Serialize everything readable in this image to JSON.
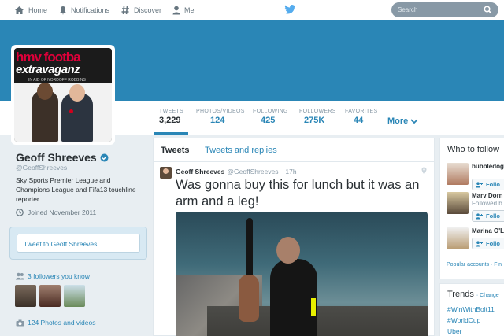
{
  "nav": {
    "home": "Home",
    "notifications": "Notifications",
    "discover": "Discover",
    "me": "Me",
    "search_placeholder": "Search"
  },
  "colors": {
    "accent": "#2a86b6",
    "header": "#2a86b6"
  },
  "stats": {
    "tweets": {
      "label": "TWEETS",
      "value": "3,229"
    },
    "photos": {
      "label": "PHOTOS/VIDEOS",
      "value": "124"
    },
    "following": {
      "label": "FOLLOWING",
      "value": "425"
    },
    "followers": {
      "label": "FOLLOWERS",
      "value": "275K"
    },
    "favorites": {
      "label": "FAVORITES",
      "value": "44"
    },
    "more": "More"
  },
  "avatar_banner": {
    "line1": "hmv footba",
    "line2": "extravaganz",
    "line3": "IN AID OF NORDOFF ROBBINS"
  },
  "profile": {
    "name": "Geoff Shreeves",
    "handle": "@GeoffShreeves",
    "bio": "Sky Sports Premier League and Champions League and Fifa13 touchline reporter",
    "joined": "Joined November 2011",
    "tweet_to": "Tweet to Geoff Shreeves",
    "followers_you_know": "3 followers you know",
    "photos_videos": "124 Photos and videos"
  },
  "timeline": {
    "tabs": [
      "Tweets",
      "Tweets and replies"
    ],
    "tweet": {
      "name": "Geoff Shreeves",
      "handle": "@GeoffShreeves",
      "separator": "·",
      "time": "17h",
      "text": "Was gonna buy this for lunch but it was an arm and a leg!"
    }
  },
  "who_to_follow": {
    "title": "Who to follow",
    "users": [
      {
        "name": "bubbledog",
        "sub": "",
        "follow": "Follo"
      },
      {
        "name": "Marv Dorn",
        "sub": "Followed b",
        "follow": "Follo"
      },
      {
        "name": "Marina O'L",
        "sub": "",
        "follow": "Follo"
      }
    ],
    "links": "Popular accounts · Fin"
  },
  "trends": {
    "title": "Trends",
    "change": "· Change",
    "items": [
      "#WinWithBolt11",
      "#WorldCup",
      "Uber"
    ]
  }
}
